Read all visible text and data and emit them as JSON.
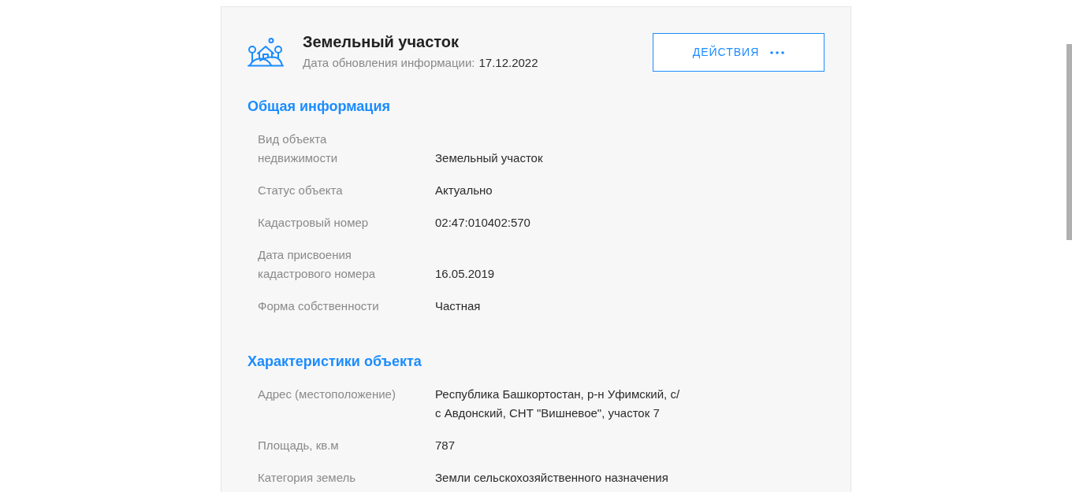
{
  "header": {
    "title": "Земельный участок",
    "updated_label": "Дата обновления информации:",
    "updated_value": "17.12.2022",
    "actions_button": "ДЕЙСТВИЯ"
  },
  "sections": [
    {
      "title": "Общая информация",
      "rows": [
        {
          "label": "Вид объекта недвижимости",
          "value": "Земельный участок"
        },
        {
          "label": "Статус объекта",
          "value": "Актуально"
        },
        {
          "label": "Кадастровый номер",
          "value": "02:47:010402:570"
        },
        {
          "label": "Дата присвоения кадастрового номера",
          "value": "16.05.2019"
        },
        {
          "label": "Форма собственности",
          "value": "Частная"
        }
      ]
    },
    {
      "title": "Характеристики объекта",
      "rows": [
        {
          "label": "Адрес (местоположение)",
          "value": "Республика Башкортостан, р-н Уфимский, с/с Авдонский, СНТ \"Вишневое\", участок 7"
        },
        {
          "label": "Площадь, кв.м",
          "value": "787"
        },
        {
          "label": "Категория земель",
          "value": "Земли сельскохозяйственного назначения"
        }
      ]
    }
  ]
}
